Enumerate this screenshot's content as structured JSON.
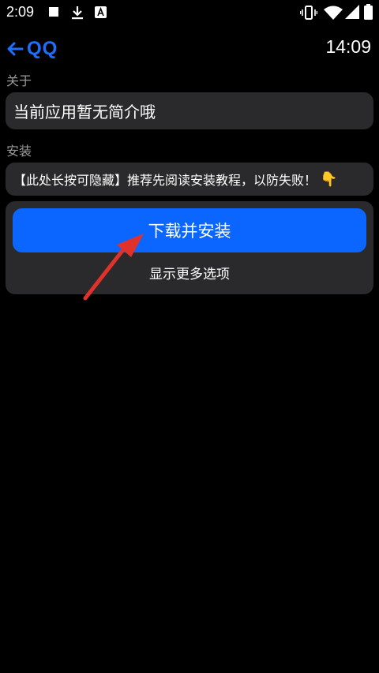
{
  "status_bar": {
    "time": "2:09",
    "left_icons": [
      "stop-square-icon",
      "download-icon",
      "accessibility-a-icon"
    ],
    "right_icons": [
      "vibrate-icon",
      "wifi-icon",
      "signal-icon",
      "battery-icon"
    ]
  },
  "app_bar": {
    "back_icon": "arrow-left-icon",
    "title": "QQ",
    "clock": "14:09"
  },
  "about": {
    "label": "关于",
    "text": "当前应用暂无简介哦"
  },
  "install": {
    "label": "安装",
    "tip": "【此处长按可隐藏】推荐先阅读安装教程，以防失败！",
    "tip_emoji": "👇",
    "primary_button": "下载并安装",
    "more_options": "显示更多选项"
  },
  "colors": {
    "accent": "#1e6fff",
    "primary_button": "#0a66ff",
    "card": "#2a2a2c",
    "label": "#9a9a9a",
    "annotation_arrow": "#e0322a"
  }
}
